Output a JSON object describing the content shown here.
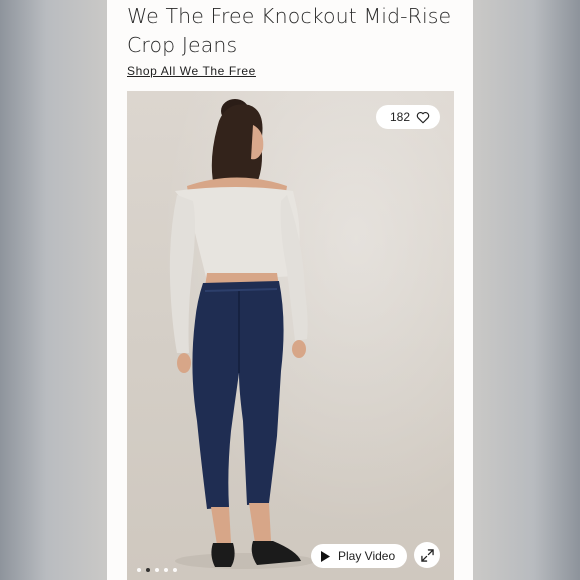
{
  "product": {
    "title": "We The Free Knockout Mid-Rise Crop Jeans",
    "shop_link": "Shop All We The Free"
  },
  "gallery": {
    "likes_count": "182",
    "play_label": "Play Video",
    "dots_total": 5,
    "active_dot": 1
  },
  "icons": {
    "like": "heart-icon",
    "play": "play-icon",
    "expand": "expand-icon"
  },
  "colors": {
    "page_bg": "#fdfcfb",
    "text": "#2a2a2a",
    "denim": "#1f2d52",
    "sweater": "#e6e3de"
  }
}
